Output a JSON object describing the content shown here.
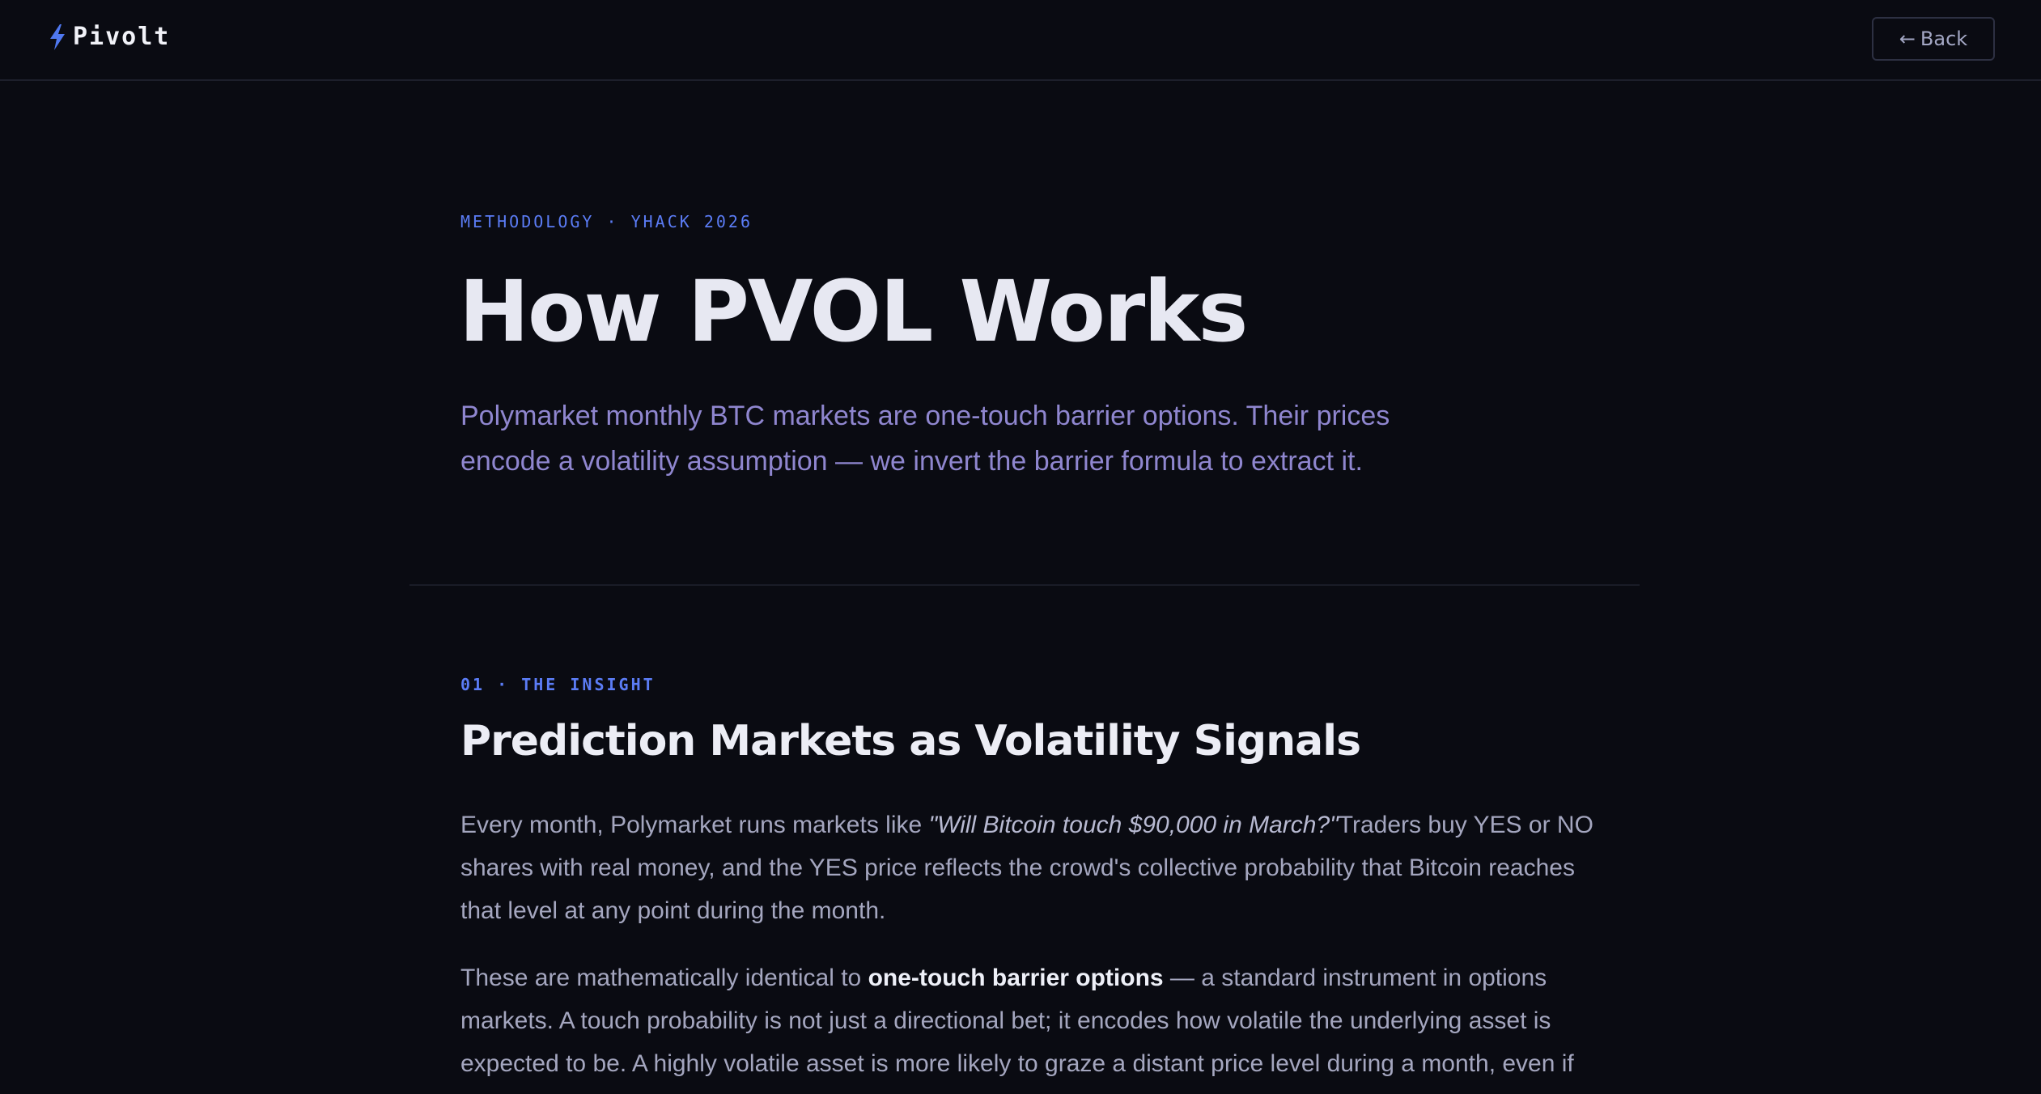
{
  "app": {
    "name": "Pivolt"
  },
  "header": {
    "back_label": "Back",
    "back_arrow": "←",
    "brand_icon": "lightning-bolt-icon",
    "accent": "#4f78f0"
  },
  "hero": {
    "eyebrow": "METHODOLOGY · YHACK 2026",
    "title": "How PVOL Works",
    "subtitle": "Polymarket monthly BTC markets are one-touch barrier options. Their prices encode a volatility assumption — we invert the barrier formula to extract it."
  },
  "section1": {
    "eyebrow": "01 · THE INSIGHT",
    "title": "Prediction Markets as Volatility Signals",
    "p1_before": "Every month, Polymarket runs markets like ",
    "p1_quote": "\"Will Bitcoin touch $90,000 in March?\"",
    "p1_after": "Traders buy YES or NO shares with real money, and the YES price reflects the crowd's collective probability that Bitcoin reaches that level at any point during the month.",
    "p2_before": "These are mathematically identical to ",
    "p2_strong": "one-touch barrier options",
    "p2_after": " — a standard instrument in options markets. A touch probability is not just a directional bet; it encodes how volatile the underlying asset is expected to be. A highly volatile asset is more likely to graze a distant price level during a month, even if"
  }
}
